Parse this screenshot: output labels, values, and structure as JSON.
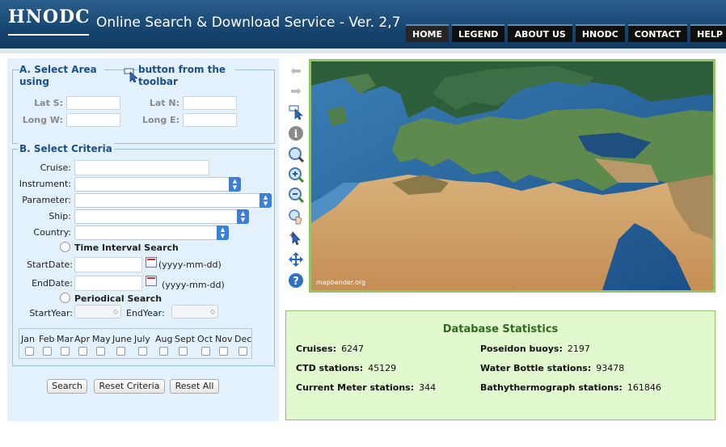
{
  "header": {
    "logo_text": "HNODC",
    "title": "Online Search & Download Service - Ver. 2,7"
  },
  "nav": [
    "HOME",
    "LEGEND",
    "ABOUT US",
    "HNODC",
    "CONTACT",
    "HELP"
  ],
  "area": {
    "legend_left": "A. Select Area using",
    "legend_right": "button from the toolbar",
    "lat_s": "Lat S:",
    "lat_n": "Lat N:",
    "long_w": "Long W:",
    "long_e": "Long E:"
  },
  "criteria": {
    "legend": "B. Select Criteria",
    "cruise": "Cruise:",
    "instrument": "Instrument:",
    "parameter": "Parameter:",
    "ship": "Ship:",
    "country": "Country:",
    "time_interval": "Time Interval Search",
    "start_date": "StartDate:",
    "end_date": "EndDate:",
    "date_format_1": "(yyyy-mm-dd)",
    "date_format_2": "(yyyy-mm-dd)",
    "periodical": "Periodical Search",
    "start_year": "StartYear:",
    "end_year": "EndYear:",
    "months": [
      "Jan",
      "Feb",
      "Mar",
      "Apr",
      "May",
      "June",
      "July",
      "Aug",
      "Sept",
      "Oct",
      "Nov",
      "Dec"
    ]
  },
  "buttons": {
    "search": "Search",
    "reset_criteria": "Reset Criteria",
    "reset_all": "Reset All"
  },
  "map": {
    "credit": "mapbender.org"
  },
  "stats": {
    "title": "Database Statistics",
    "cruises_label": "Cruises:",
    "cruises": "6247",
    "poseidon_label": "Poseidon buoys:",
    "poseidon": "2197",
    "ctd_label": "CTD stations:",
    "ctd": "45129",
    "bottle_label": "Water Bottle stations:",
    "bottle": "93478",
    "meter_label": "Current Meter stations:",
    "meter": "344",
    "bathy_label": "Bathythermograph stations:",
    "bathy": "161846"
  },
  "toolbar_icons": [
    "back-arrow-icon",
    "forward-arrow-icon",
    "select-area-icon",
    "info-icon",
    "zoom-full-icon",
    "zoom-in-icon",
    "zoom-out-icon",
    "pan-hand-icon",
    "pointer-icon",
    "move-cross-icon",
    "help-icon"
  ]
}
